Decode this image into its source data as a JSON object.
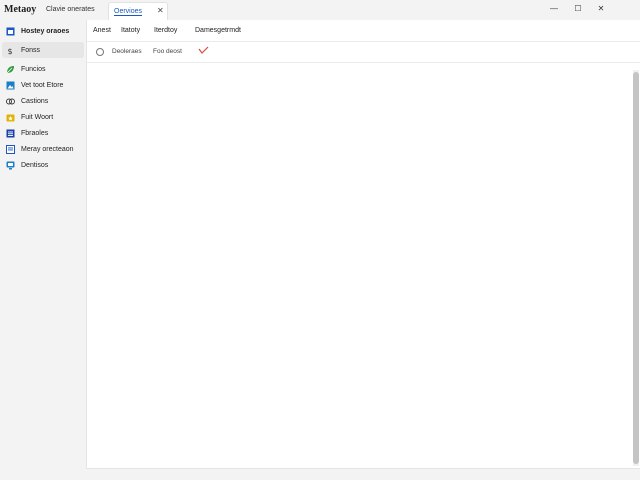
{
  "window": {
    "app_title": "Metaoy",
    "subtitle": "Clavie onerates",
    "tab_label": "Oervioes",
    "tab_close": "✕",
    "minimize": "—",
    "maximize": "☐",
    "close": "✕"
  },
  "sidebar": {
    "items": [
      {
        "label": "Hostey oraoes",
        "icon": "window-icon",
        "color": "#1a56c4"
      },
      {
        "label": "Fonss",
        "icon": "dollar-icon",
        "color": "#333333"
      },
      {
        "label": "Funcios",
        "icon": "leaf-icon",
        "color": "#2e9d3a"
      },
      {
        "label": "Vet toot Etore",
        "icon": "image-icon",
        "color": "#1a7fc4"
      },
      {
        "label": "Castions",
        "icon": "link-icon",
        "color": "#333333"
      },
      {
        "label": "Fuit Woort",
        "icon": "star-folder-icon",
        "color": "#e0b300"
      },
      {
        "label": "Fbraoles",
        "icon": "list-icon",
        "color": "#1a3fa8"
      },
      {
        "label": "Meray orecteaon",
        "icon": "doc-icon",
        "color": "#1a56c4"
      },
      {
        "label": "Dentisos",
        "icon": "monitor-icon",
        "color": "#1a7fc4"
      }
    ]
  },
  "menu": {
    "items": [
      "Anest",
      "Itatoty",
      "Iterdtoy",
      "Damesgetrmdt"
    ]
  },
  "toolbar": {
    "items": [
      "Deoleraes",
      "Foo deost"
    ]
  },
  "colors": {
    "accent": "#1a56c4",
    "check": "#d9473f"
  }
}
